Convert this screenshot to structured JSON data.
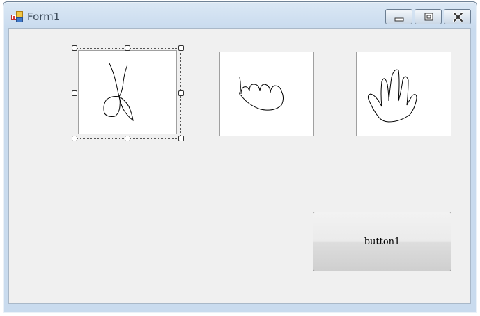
{
  "window": {
    "title": "Form1",
    "icons": {
      "app": "form-app-icon",
      "minimize": "minimize-icon",
      "maximize": "maximize-icon",
      "close": "close-icon"
    }
  },
  "form": {
    "picture_boxes": [
      {
        "name": "picturebox-scissors",
        "image": "scissors-drawing",
        "selected": true
      },
      {
        "name": "picturebox-rock",
        "image": "rock-fist-drawing",
        "selected": false
      },
      {
        "name": "picturebox-paper",
        "image": "paper-hand-drawing",
        "selected": false
      }
    ],
    "button1": {
      "label": "button1"
    }
  },
  "colors": {
    "client_bg": "#f0f0f0",
    "titlebar": "#c9dbee",
    "picture_bg": "#ffffff"
  }
}
